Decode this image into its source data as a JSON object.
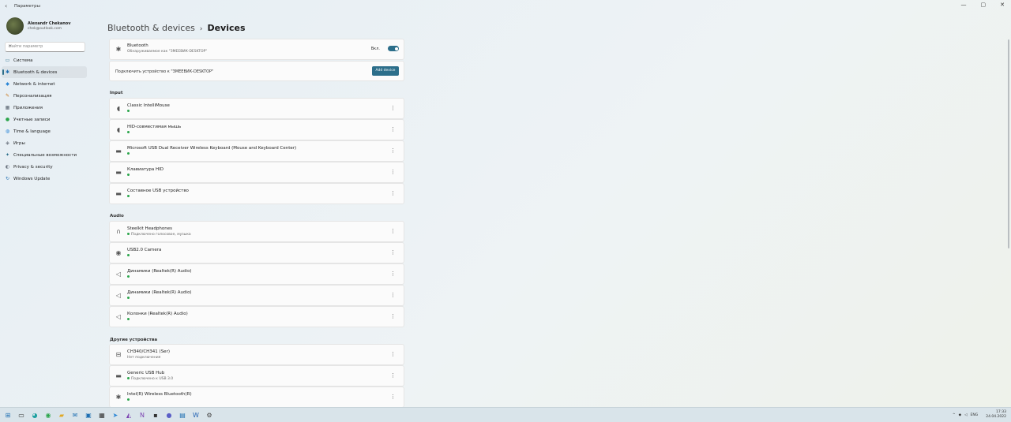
{
  "window": {
    "title": "Параметры",
    "back_glyph": "‹",
    "buttons": [
      "—",
      "▢",
      "✕"
    ]
  },
  "user": {
    "name": "Alexandr Chekanov",
    "email": "chek@outlook.com"
  },
  "search": {
    "placeholder": "Найти параметр"
  },
  "sidebar": {
    "items": [
      {
        "label": "Система",
        "icon": "monitor-icon",
        "glyph": "▭",
        "color": "#2c6e8a"
      },
      {
        "label": "Bluetooth & devices",
        "icon": "bluetooth-icon",
        "glyph": "✱",
        "color": "#1f6fb2",
        "active": true
      },
      {
        "label": "Network & internet",
        "icon": "wifi-icon",
        "glyph": "◆",
        "color": "#2b86d6"
      },
      {
        "label": "Персонализация",
        "icon": "brush-icon",
        "glyph": "✎",
        "color": "#c9781e"
      },
      {
        "label": "Приложения",
        "icon": "apps-icon",
        "glyph": "▦",
        "color": "#5a6470"
      },
      {
        "label": "Учетные записи",
        "icon": "person-icon",
        "glyph": "●",
        "color": "#2ba54b"
      },
      {
        "label": "Time & language",
        "icon": "globe-icon",
        "glyph": "◍",
        "color": "#2b86d6"
      },
      {
        "label": "Игры",
        "icon": "gamepad-icon",
        "glyph": "◈",
        "color": "#6d7580"
      },
      {
        "label": "Специальные возможности",
        "icon": "accessibility-icon",
        "glyph": "✦",
        "color": "#2c6e8a"
      },
      {
        "label": "Privacy & security",
        "icon": "shield-icon",
        "glyph": "◐",
        "color": "#6d7580"
      },
      {
        "label": "Windows Update",
        "icon": "update-icon",
        "glyph": "↻",
        "color": "#1f6fb2"
      }
    ]
  },
  "breadcrumb": {
    "parent": "Bluetooth & devices",
    "separator": "›",
    "current": "Devices"
  },
  "bluetooth_card": {
    "title": "Bluetooth",
    "subtitle": "Обнаруживаемое как \"ЗМЕЕВИК-DESKTOP\"",
    "toggle_label": "Вкл.",
    "toggle_on": true
  },
  "pair_card": {
    "text": "Подключить устройство к \"ЗМЕЕВИК-DESKTOP\"",
    "button": "Add device"
  },
  "sections": {
    "input": "Input",
    "audio": "Audio",
    "other": "Другие устройства"
  },
  "input_devices": [
    {
      "name": "Classic IntelliMouse",
      "status": "",
      "icon": "mouse-icon",
      "glyph": "◖"
    },
    {
      "name": "HID-совместимая мышь",
      "status": "",
      "icon": "mouse-icon",
      "glyph": "◖"
    },
    {
      "name": "Microsoft USB Dual Receiver Wireless Keyboard (Mouse and Keyboard Center)",
      "status": "",
      "icon": "keyboard-icon",
      "glyph": "▬"
    },
    {
      "name": "Клавиатура HID",
      "status": "",
      "icon": "keyboard-icon",
      "glyph": "▬"
    },
    {
      "name": "Составное USB устройство",
      "status": "",
      "icon": "keyboard-icon",
      "glyph": "▬"
    }
  ],
  "audio_devices": [
    {
      "name": "Steelkit Headphones",
      "status": "Подключено голосовое, музыка",
      "icon": "headphones-icon",
      "glyph": "∩"
    },
    {
      "name": "USB2.0 Camera",
      "status": "",
      "icon": "camera-icon",
      "glyph": "◉"
    },
    {
      "name": "Динамики (Realtek(R) Audio)",
      "status": "",
      "icon": "speaker-icon",
      "glyph": "◁"
    },
    {
      "name": "Динамики (Realtek(R) Audio)",
      "status": "",
      "icon": "speaker-icon",
      "glyph": "◁"
    },
    {
      "name": "Колонки (Realtek(R) Audio)",
      "status": "",
      "icon": "speaker-icon",
      "glyph": "◁"
    }
  ],
  "other_devices": [
    {
      "name": "CH340/CH341 (Ser)",
      "status": "Нет подключения",
      "icon": "usb-icon",
      "glyph": "⊟",
      "no_dot": true
    },
    {
      "name": "Generic USB Hub",
      "status": "Подключено к USB 3.0",
      "icon": "hub-icon",
      "glyph": "▬"
    },
    {
      "name": "Intel(R) Wireless Bluetooth(R)",
      "status": "",
      "icon": "bluetooth-icon",
      "glyph": "✱"
    }
  ],
  "more_glyph": "⋮",
  "taskbar": {
    "apps": [
      {
        "icon": "start-icon",
        "glyph": "⊞",
        "color": "#1f6fb2"
      },
      {
        "icon": "task-view-icon",
        "glyph": "▭",
        "color": "#333"
      },
      {
        "icon": "edge-icon",
        "glyph": "◕",
        "color": "#1fa0a0"
      },
      {
        "icon": "chrome-icon",
        "glyph": "◉",
        "color": "#2ba54b"
      },
      {
        "icon": "explorer-icon",
        "glyph": "▰",
        "color": "#e0a825"
      },
      {
        "icon": "mail-icon",
        "glyph": "✉",
        "color": "#1f6fb2"
      },
      {
        "icon": "store-icon",
        "glyph": "▣",
        "color": "#1f6fb2"
      },
      {
        "icon": "calculator-icon",
        "glyph": "▦",
        "color": "#333"
      },
      {
        "icon": "telegram-icon",
        "glyph": "➤",
        "color": "#2b86d6"
      },
      {
        "icon": "visual-studio-icon",
        "glyph": "◭",
        "color": "#7a3fb0"
      },
      {
        "icon": "onenote-icon",
        "glyph": "N",
        "color": "#7a3fb0"
      },
      {
        "icon": "terminal-icon",
        "glyph": "▪",
        "color": "#333"
      },
      {
        "icon": "teams-icon",
        "glyph": "●",
        "color": "#5b5fc7"
      },
      {
        "icon": "notepad-icon",
        "glyph": "▤",
        "color": "#1f6fb2"
      },
      {
        "icon": "word-icon",
        "glyph": "W",
        "color": "#1f5fb2"
      },
      {
        "icon": "settings-icon",
        "glyph": "⚙",
        "color": "#444"
      }
    ],
    "tray": {
      "chevron": "^",
      "lang": "ENG",
      "time": "17:33",
      "date": "24.04.2022"
    }
  }
}
